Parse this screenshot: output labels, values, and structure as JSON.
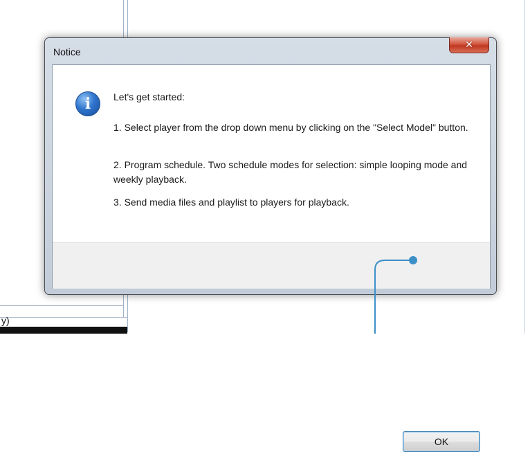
{
  "background": {
    "cut_text": "y)"
  },
  "dialog": {
    "title": "Notice",
    "close_glyph": "✕",
    "icon": "info-icon",
    "heading": "Let's get started:",
    "steps": [
      "1. Select player from the drop down menu by clicking on the \"Select Model\" button.",
      "2. Program schedule. Two schedule modes for selection: simple looping mode and weekly playback.",
      "3. Send media files and playlist to players for playback."
    ],
    "ok_label": "OK"
  },
  "colors": {
    "accent": "#3d8fc8",
    "close_red": "#c1361f",
    "info_blue": "#2f74cc"
  }
}
